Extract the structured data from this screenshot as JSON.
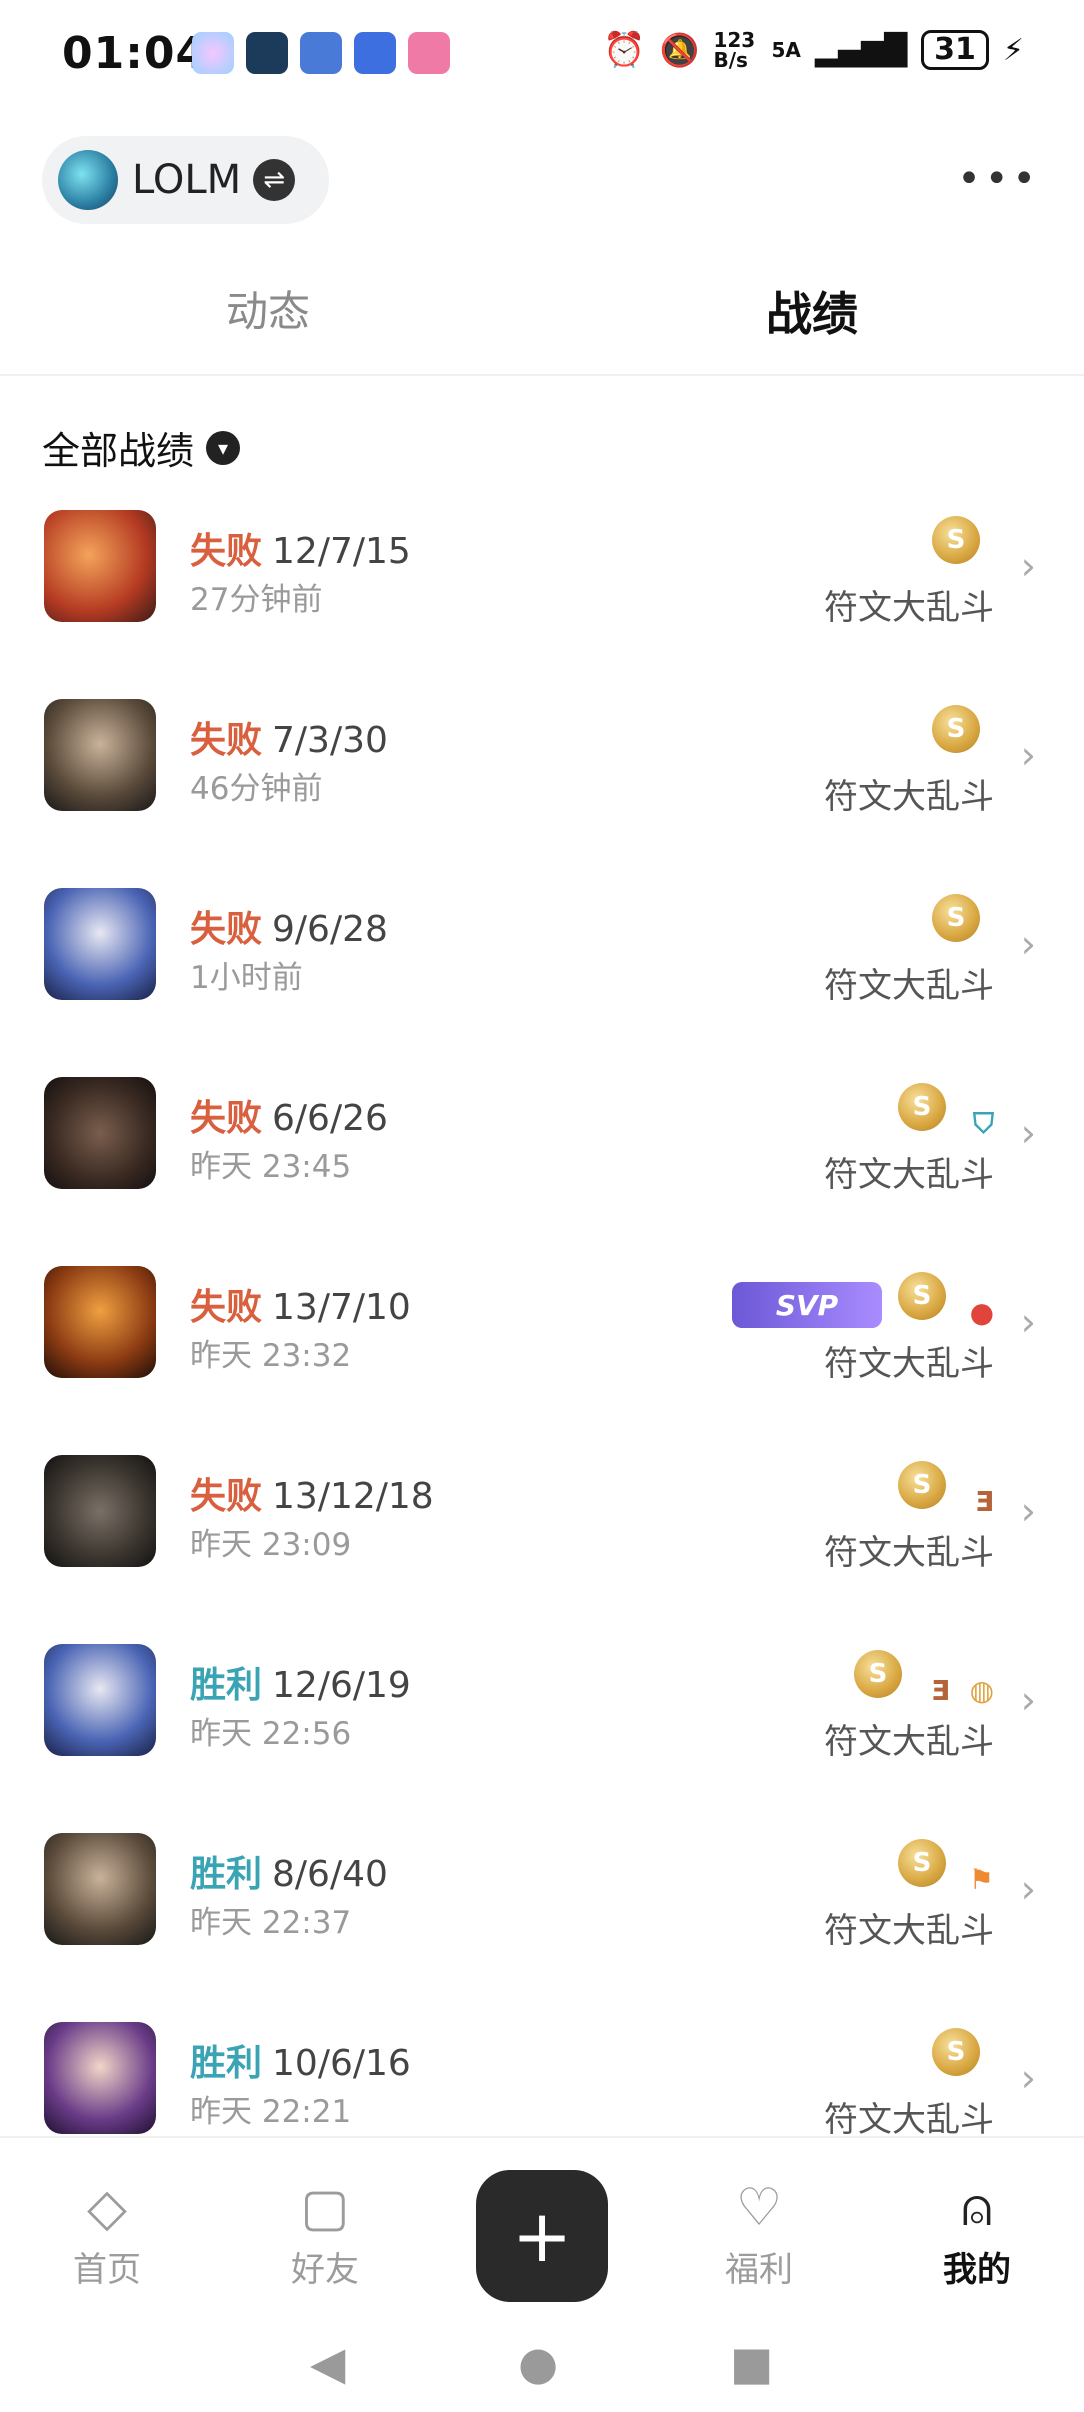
{
  "status_bar": {
    "time": "01:04",
    "net_speed": "123 B/s",
    "signal": "5A",
    "battery": "31"
  },
  "header": {
    "game_name": "LOLM",
    "more": "•••"
  },
  "tabs": [
    {
      "label": "动态"
    },
    {
      "label": "战绩"
    }
  ],
  "filter": {
    "label": "全部战绩",
    "caret": "▾"
  },
  "matches": [
    {
      "result": "失败",
      "kda": "12/7/15",
      "time": "27分钟前",
      "mode": "符文大乱斗",
      "win": false,
      "badges": [
        "coin"
      ]
    },
    {
      "result": "失败",
      "kda": "7/3/30",
      "time": "46分钟前",
      "mode": "符文大乱斗",
      "win": false,
      "badges": [
        "coin"
      ]
    },
    {
      "result": "失败",
      "kda": "9/6/28",
      "time": "1小时前",
      "mode": "符文大乱斗",
      "win": false,
      "badges": [
        "coin"
      ]
    },
    {
      "result": "失败",
      "kda": "6/6/26",
      "time": "昨天 23:45",
      "mode": "符文大乱斗",
      "win": false,
      "badges": [
        "coin",
        "shield"
      ]
    },
    {
      "result": "失败",
      "kda": "13/7/10",
      "time": "昨天 23:32",
      "mode": "符文大乱斗",
      "win": false,
      "badges": [
        "svp",
        "coin",
        "blood"
      ]
    },
    {
      "result": "失败",
      "kda": "13/12/18",
      "time": "昨天 23:09",
      "mode": "符文大乱斗",
      "win": false,
      "badges": [
        "coin",
        "triple"
      ]
    },
    {
      "result": "胜利",
      "kda": "12/6/19",
      "time": "昨天 22:56",
      "mode": "符文大乱斗",
      "win": true,
      "badges": [
        "coin",
        "triple",
        "gold"
      ]
    },
    {
      "result": "胜利",
      "kda": "8/6/40",
      "time": "昨天 22:37",
      "mode": "符文大乱斗",
      "win": true,
      "badges": [
        "coin",
        "flag"
      ]
    },
    {
      "result": "胜利",
      "kda": "10/6/16",
      "time": "昨天 22:21",
      "mode": "符文大乱斗",
      "win": true,
      "badges": [
        "coin"
      ]
    }
  ],
  "badge_text": {
    "coin": "S",
    "svp": "SVP",
    "triple": "Ǝ"
  },
  "colors": {
    "lose": "#d9603f",
    "win": "#3aa4b5"
  },
  "bottom_nav": [
    {
      "label": "首页",
      "icon": "home-icon"
    },
    {
      "label": "好友",
      "icon": "chat-icon"
    },
    {
      "label": "",
      "icon": "plus-icon"
    },
    {
      "label": "福利",
      "icon": "gift-icon"
    },
    {
      "label": "我的",
      "icon": "profile-icon"
    }
  ]
}
